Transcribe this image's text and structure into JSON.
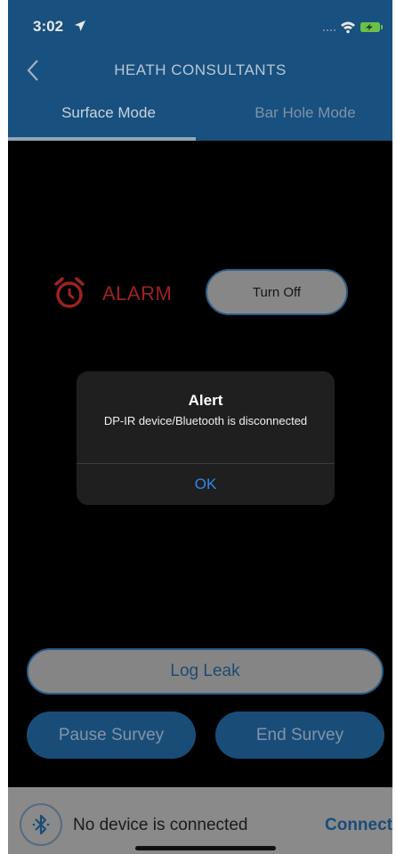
{
  "status_bar": {
    "time": "3:02"
  },
  "header": {
    "title": "HEATH CONSULTANTS",
    "tabs": [
      {
        "label": "Surface Mode",
        "active": true
      },
      {
        "label": "Bar Hole Mode",
        "active": false
      }
    ]
  },
  "alarm": {
    "label": "ALARM",
    "turn_off_label": "Turn Off",
    "color": "#9e2222"
  },
  "alert": {
    "title": "Alert",
    "message": "DP-IR device/Bluetooth is disconnected",
    "ok_label": "OK"
  },
  "actions": {
    "log_leak_label": "Log Leak",
    "pause_label": "Pause Survey",
    "end_label": "End Survey"
  },
  "bottom_bar": {
    "status_text": "No device is connected",
    "connect_label": "Connect"
  },
  "colors": {
    "brand_blue": "#18507f",
    "link_blue": "#2f89e8"
  }
}
